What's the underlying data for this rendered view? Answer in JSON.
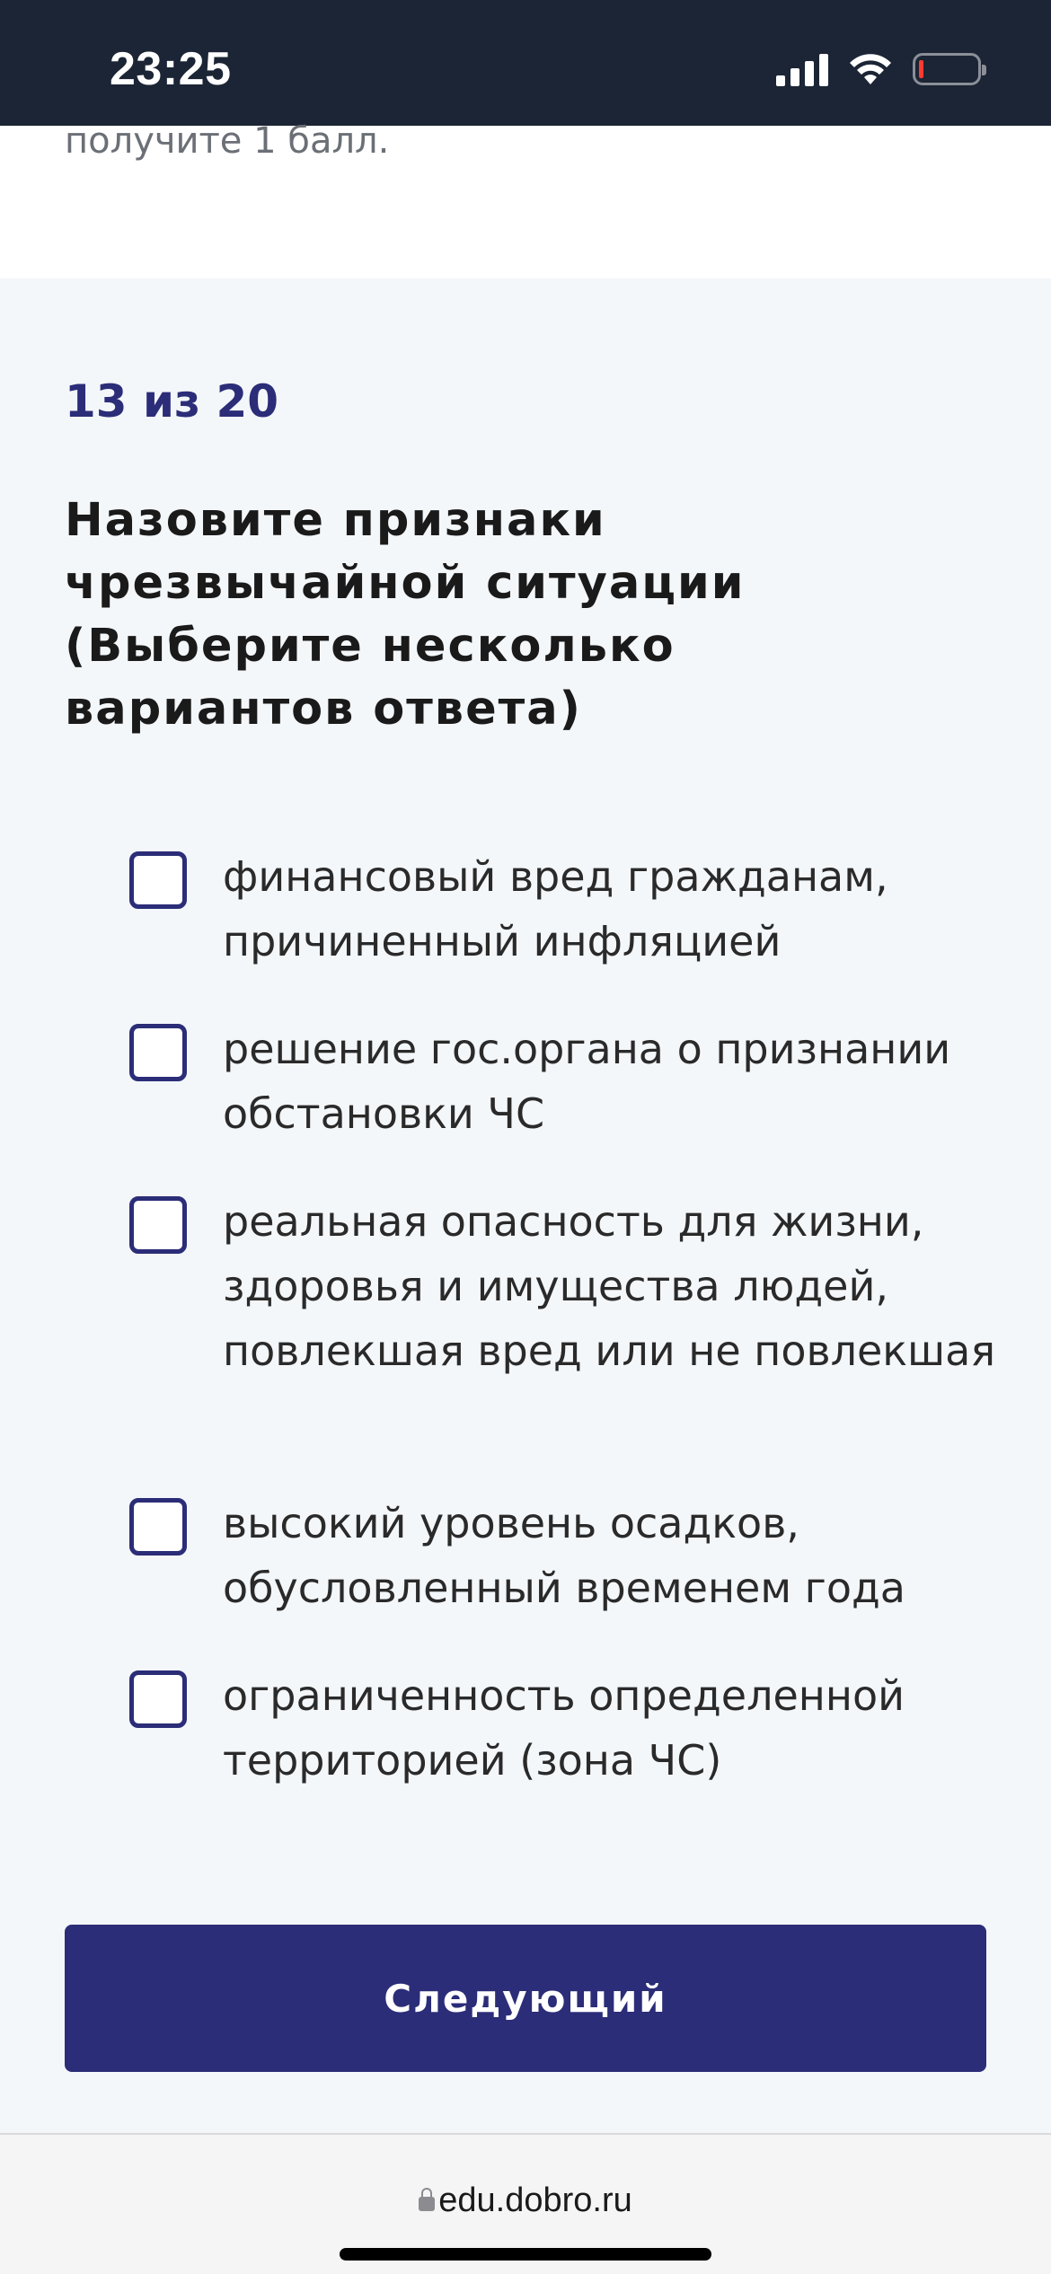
{
  "status_bar": {
    "time": "23:25",
    "icons": [
      "cellular-signal-icon",
      "wifi-icon",
      "battery-low-icon"
    ],
    "battery_level": 0.05
  },
  "intro": {
    "text": "получите 1 балл."
  },
  "quiz": {
    "progress": "13 из 20",
    "question": "Назовите признаки чрезвычайной ситуации (Выберите несколько вариантов ответа)",
    "options": [
      {
        "label": "финансовый вред гражданам, причиненный инфляцией",
        "checked": false
      },
      {
        "label": "решение гос.органа о признании обстановки ЧС",
        "checked": false
      },
      {
        "label": "реальная опасность для жизни, здоровья и имущества людей, повлекшая вред или не повлекшая",
        "checked": false
      },
      {
        "label": "высокий уровень осадков, обусловленный временем года",
        "checked": false
      },
      {
        "label": "ограниченность определенной территорией (зона ЧС)",
        "checked": false
      }
    ],
    "next_label": "Следующий"
  },
  "browser": {
    "url": "edu.dobro.ru"
  },
  "colors": {
    "accent": "#2b2d78",
    "status_bar_bg": "#1b2535",
    "page_bg": "#f4f7fa"
  }
}
